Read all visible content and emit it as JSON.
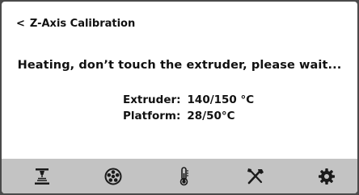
{
  "header": {
    "back_symbol": "<",
    "title": "Z-Axis Calibration"
  },
  "status_message": "Heating, don’t touch the extruder, please wait...",
  "temperatures": {
    "extruder_label": "Extruder:",
    "extruder_value": "140/150 °C",
    "platform_label": "Platform:",
    "platform_value": "28/50°C"
  },
  "toolbar": {
    "icons": [
      "print-icon",
      "filament-icon",
      "temperature-icon",
      "tools-icon",
      "settings-icon"
    ]
  },
  "colors": {
    "screen_bg": "#ffffff",
    "toolbar_bg": "#c3c3c3",
    "icon": "#1a1a1a",
    "bezel": "#4a4a4a"
  }
}
